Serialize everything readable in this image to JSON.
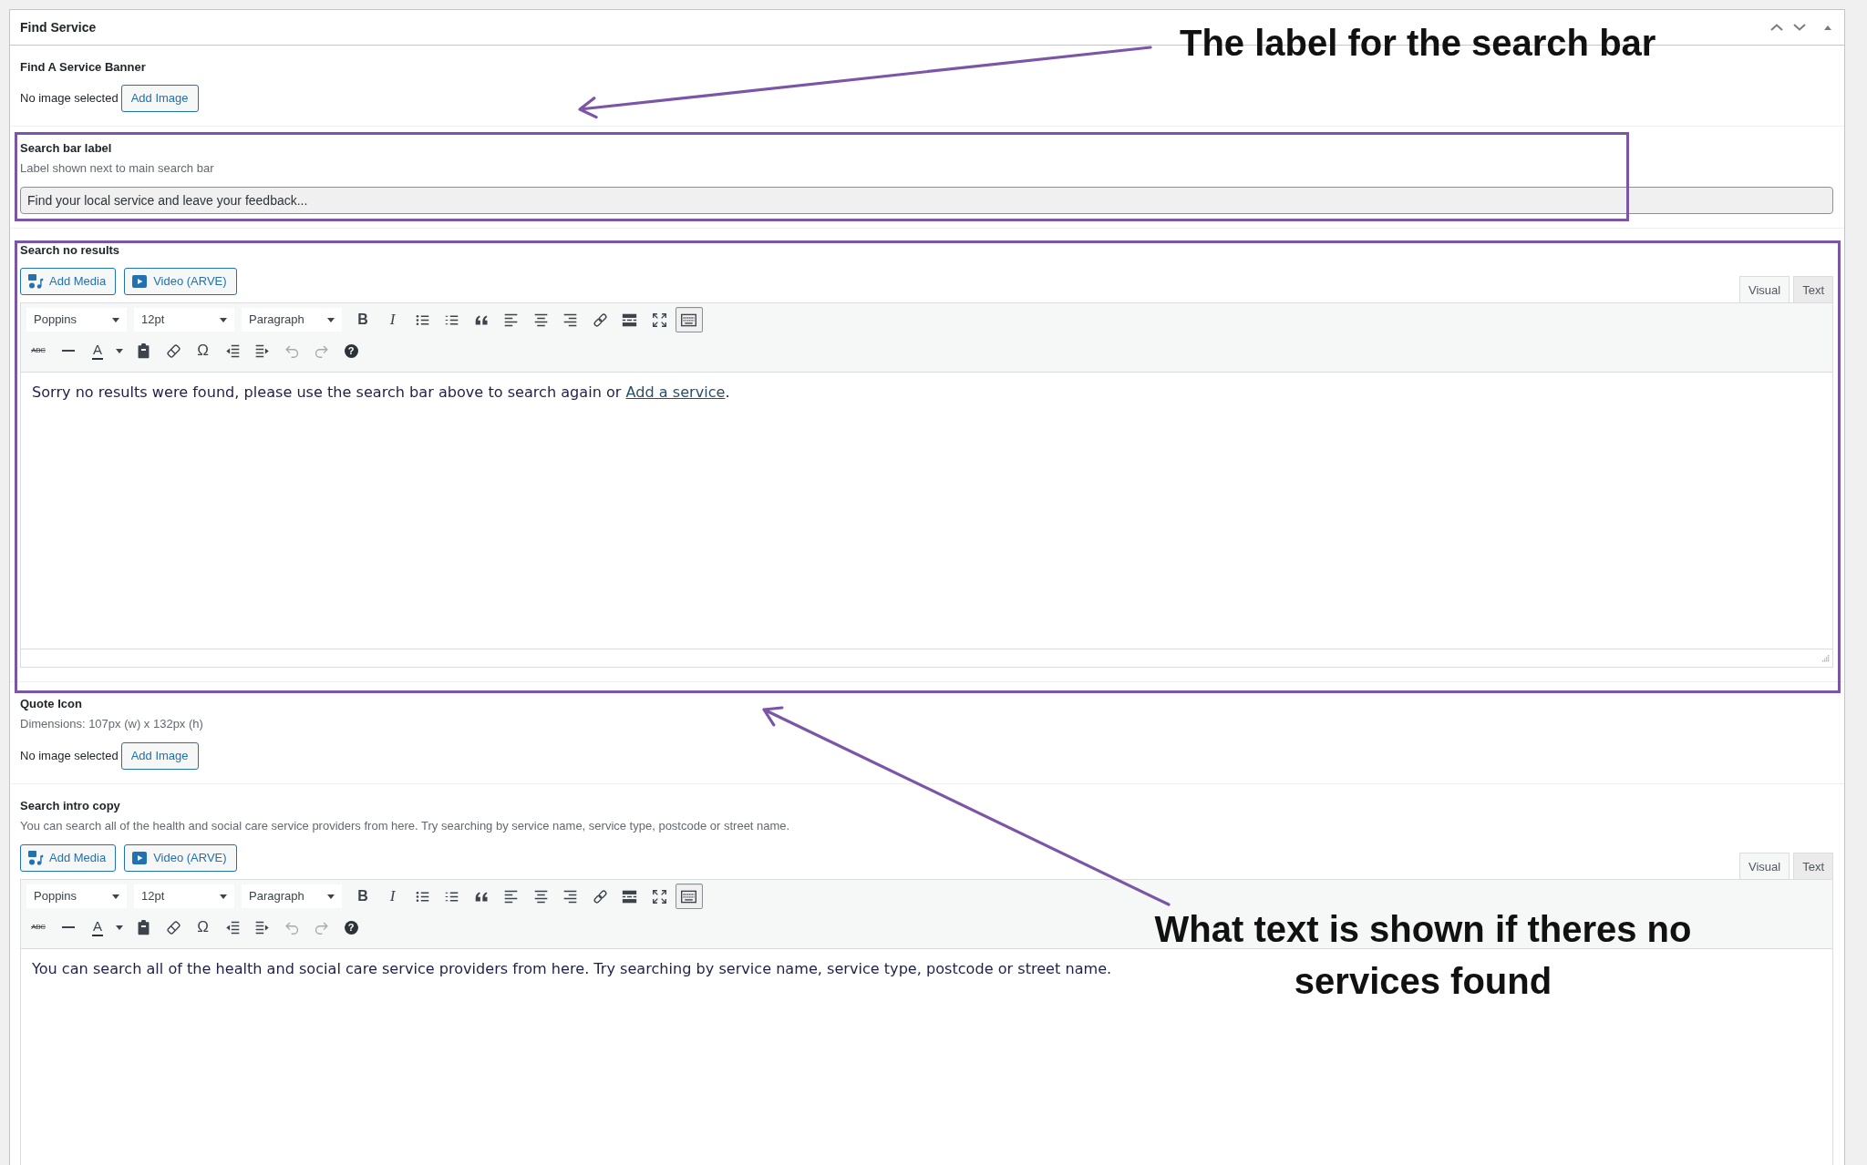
{
  "panel": {
    "title": "Find Service",
    "expanded": true
  },
  "fields": [
    {
      "kind": "image",
      "label": "Find A Service Banner",
      "status": "No image selected",
      "button": "Add Image"
    },
    {
      "kind": "text",
      "label": "Search bar label",
      "description": "Label shown next to main search bar",
      "value": "Find your local service and leave your feedback..."
    },
    {
      "kind": "editor",
      "label": "Search no results",
      "media_buttons": [
        {
          "kind": "media",
          "text": "Add Media"
        },
        {
          "kind": "video",
          "text": "Video (ARVE)"
        }
      ],
      "tabs": [
        {
          "label": "Visual",
          "selected": true
        },
        {
          "label": "Text",
          "selected": false
        }
      ],
      "toolbar": {
        "selects": [
          "Poppins",
          "12pt",
          "Paragraph"
        ],
        "buttons": [
          [
            {
              "kind": "bold",
              "text": "B",
              "pressed": false,
              "disabled": false
            },
            {
              "kind": "italic",
              "text": "I",
              "pressed": false,
              "disabled": false
            },
            {
              "kind": "bullets",
              "pressed": false,
              "disabled": false
            },
            {
              "kind": "numbers",
              "pressed": false,
              "disabled": false
            },
            {
              "kind": "blockquote",
              "pressed": false,
              "disabled": false
            },
            {
              "kind": "alignleft",
              "pressed": false,
              "disabled": false
            },
            {
              "kind": "aligncenter",
              "pressed": false,
              "disabled": false
            },
            {
              "kind": "alignright",
              "pressed": false,
              "disabled": false
            },
            {
              "kind": "link",
              "pressed": false,
              "disabled": false
            },
            {
              "kind": "more",
              "pressed": false,
              "disabled": false
            },
            {
              "kind": "fullscreen",
              "pressed": false,
              "disabled": false
            },
            {
              "kind": "toolbar",
              "pressed": true,
              "disabled": false
            }
          ],
          [
            {
              "kind": "strikethrough",
              "text": "ABC",
              "pressed": false,
              "disabled": false
            },
            {
              "kind": "hr",
              "pressed": false,
              "disabled": false
            },
            {
              "kind": "forecolor",
              "text": "A",
              "pressed": false,
              "disabled": false
            },
            {
              "kind": "paste",
              "pressed": false,
              "disabled": false
            },
            {
              "kind": "eraser",
              "pressed": false,
              "disabled": false
            },
            {
              "kind": "charmap",
              "text": "Ω",
              "pressed": false,
              "disabled": false
            },
            {
              "kind": "outdent",
              "pressed": false,
              "disabled": false
            },
            {
              "kind": "indent",
              "pressed": false,
              "disabled": false
            },
            {
              "kind": "undo",
              "pressed": false,
              "disabled": true
            },
            {
              "kind": "redo",
              "pressed": false,
              "disabled": true
            },
            {
              "kind": "help",
              "text": "?",
              "pressed": false,
              "disabled": false
            }
          ]
        ]
      },
      "content": [
        {
          "kind": "text",
          "text": "Sorry no results were found, please use the search bar above to search again or "
        },
        {
          "kind": "link",
          "text": "Add a service"
        },
        {
          "kind": "text",
          "text": "."
        }
      ]
    },
    {
      "kind": "image",
      "label": "Quote Icon",
      "description": "Dimensions: 107px (w) x 132px (h)",
      "status": "No image selected",
      "button": "Add Image"
    },
    {
      "kind": "editor",
      "label": "Search intro copy",
      "description": "You can search all of the health and social care service providers from here. Try searching by service name, service type, postcode or street name.",
      "media_buttons": [
        {
          "kind": "media",
          "text": "Add Media"
        },
        {
          "kind": "video",
          "text": "Video (ARVE)"
        }
      ],
      "tabs": [
        {
          "label": "Visual",
          "selected": true
        },
        {
          "label": "Text",
          "selected": false
        }
      ],
      "toolbar": {
        "selects": [
          "Poppins",
          "12pt",
          "Paragraph"
        ],
        "buttons": [
          [
            {
              "kind": "bold",
              "text": "B",
              "pressed": false,
              "disabled": false
            },
            {
              "kind": "italic",
              "text": "I",
              "pressed": false,
              "disabled": false
            },
            {
              "kind": "bullets",
              "pressed": false,
              "disabled": false
            },
            {
              "kind": "numbers",
              "pressed": false,
              "disabled": false
            },
            {
              "kind": "blockquote",
              "pressed": false,
              "disabled": false
            },
            {
              "kind": "alignleft",
              "pressed": false,
              "disabled": false
            },
            {
              "kind": "aligncenter",
              "pressed": false,
              "disabled": false
            },
            {
              "kind": "alignright",
              "pressed": false,
              "disabled": false
            },
            {
              "kind": "link",
              "pressed": false,
              "disabled": false
            },
            {
              "kind": "more",
              "pressed": false,
              "disabled": false
            },
            {
              "kind": "fullscreen",
              "pressed": false,
              "disabled": false
            },
            {
              "kind": "toolbar",
              "pressed": true,
              "disabled": false
            }
          ],
          [
            {
              "kind": "strikethrough",
              "text": "ABC",
              "pressed": false,
              "disabled": false
            },
            {
              "kind": "hr",
              "pressed": false,
              "disabled": false
            },
            {
              "kind": "forecolor",
              "text": "A",
              "pressed": false,
              "disabled": false
            },
            {
              "kind": "paste",
              "pressed": false,
              "disabled": false
            },
            {
              "kind": "eraser",
              "pressed": false,
              "disabled": false
            },
            {
              "kind": "charmap",
              "text": "Ω",
              "pressed": false,
              "disabled": false
            },
            {
              "kind": "outdent",
              "pressed": false,
              "disabled": false
            },
            {
              "kind": "indent",
              "pressed": false,
              "disabled": false
            },
            {
              "kind": "undo",
              "pressed": false,
              "disabled": true
            },
            {
              "kind": "redo",
              "pressed": false,
              "disabled": true
            },
            {
              "kind": "help",
              "text": "?",
              "pressed": false,
              "disabled": false
            }
          ]
        ]
      },
      "content": [
        {
          "kind": "text",
          "text": "You can search all of the health and social care service providers from here. Try searching by service name, service type, postcode or street name."
        }
      ]
    }
  ],
  "annotations": [
    {
      "kind": "callout",
      "text": "The label for the search bar"
    },
    {
      "kind": "callout",
      "text": "What text is shown if theres no services found"
    }
  ]
}
